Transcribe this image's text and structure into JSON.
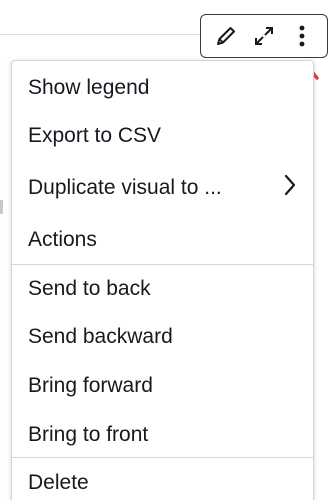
{
  "toolbar": {
    "buttons": [
      {
        "icon": "pencil-icon"
      },
      {
        "icon": "expand-icon"
      },
      {
        "icon": "more-vertical-icon"
      }
    ]
  },
  "annotation": {
    "arrow_color": "#e8413a"
  },
  "menu": {
    "items": [
      {
        "label": "Show legend"
      },
      {
        "label": "Export to CSV"
      },
      {
        "label": "Duplicate visual to ...",
        "submenu_icon": "chevron-right-icon"
      },
      {
        "label": "Actions"
      },
      {
        "label": "Send to back"
      },
      {
        "label": "Send backward"
      },
      {
        "label": "Bring forward"
      },
      {
        "label": "Bring to front"
      },
      {
        "label": "Delete"
      }
    ]
  }
}
